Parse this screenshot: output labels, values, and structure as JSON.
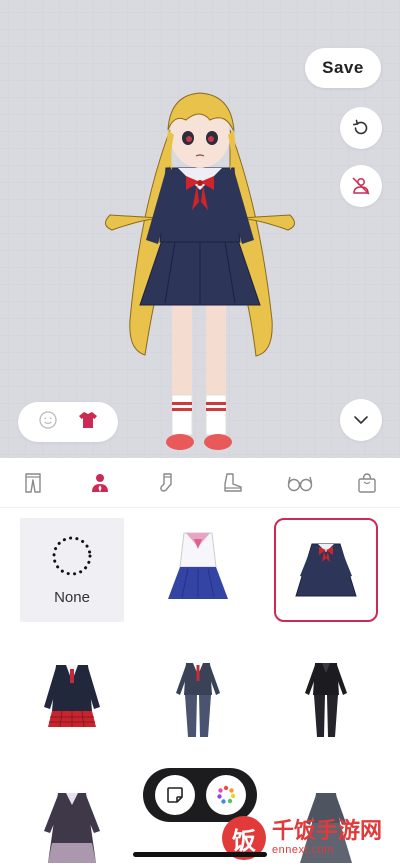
{
  "toolbar": {
    "save_label": "Save"
  },
  "preview": {
    "mode_toggle": {
      "options": [
        "face-icon",
        "shirt-icon"
      ],
      "selected": "shirt-icon"
    },
    "buttons": [
      "reset-icon",
      "hide-clothing-icon",
      "chevron-down-icon"
    ]
  },
  "category_tabs": [
    {
      "icon": "pants-icon",
      "selected": false
    },
    {
      "icon": "outfit-icon",
      "selected": true
    },
    {
      "icon": "sock-icon",
      "selected": false
    },
    {
      "icon": "boots-icon",
      "selected": false
    },
    {
      "icon": "glasses-icon",
      "selected": false
    },
    {
      "icon": "bag-icon",
      "selected": false
    }
  ],
  "items": {
    "none_label": "None",
    "selected_index": 2,
    "list": [
      "none",
      "sailor-top-blue-skirt",
      "navy-sailor-dress",
      "blazer-red-plaid-skirt",
      "gray-suit-red-tie",
      "black-suit",
      "dark-coat-lace",
      "empty",
      "gray-dress"
    ]
  },
  "floating_bar": {
    "buttons": [
      "sticker-icon",
      "palette-icon"
    ]
  },
  "watermark": {
    "logo_char": "饭",
    "name": "千饭手游网",
    "url": "ennext.com"
  },
  "colors": {
    "accent": "#cc2a52",
    "preview_bg": "#f3f3f6",
    "float_bar": "#1c1c1e"
  }
}
